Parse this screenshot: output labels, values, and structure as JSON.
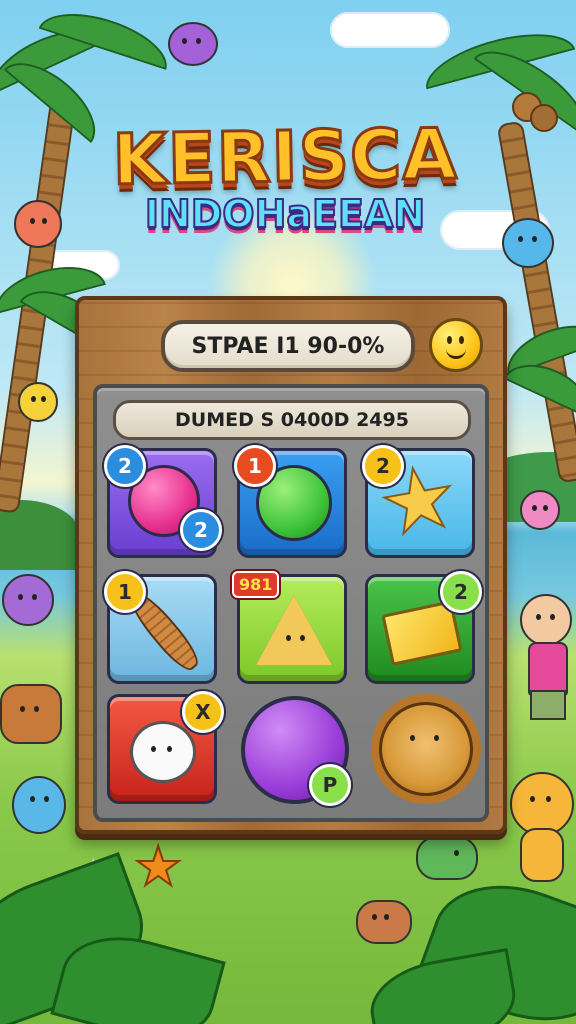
{
  "game": {
    "title": "KERISCA",
    "subtitle": "INDOHaEEAN"
  },
  "hud": {
    "status_text": "STPAE I1 90-0%",
    "score_text": "DUMED S 0400D 2495",
    "mood_icon": "smiley-face-icon"
  },
  "board": {
    "tiles": [
      {
        "name": "pink-gem-tile",
        "icon": "pink-orb",
        "badges": [
          "2",
          "2"
        ],
        "tile_color": "#7b4fe0",
        "item_color": "#e8318f"
      },
      {
        "name": "green-gem-tile",
        "icon": "green-orb",
        "badges": [
          "1"
        ],
        "tile_color": "#1f7fd6",
        "item_color": "#3fc43a"
      },
      {
        "name": "star-tile",
        "icon": "yellow-star",
        "badges": [
          "2"
        ],
        "tile_color": "#48b7e8",
        "item_color": "#f4c43a"
      },
      {
        "name": "carrot-tile",
        "icon": "carrot",
        "badges": [
          "1"
        ],
        "tile_color": "#6db6e0",
        "item_color": "#c07a3a"
      },
      {
        "name": "nacho-tile",
        "icon": "nacho-chip",
        "badges": [
          "981"
        ],
        "tile_color": "#8fd43a",
        "item_color": "#f2c85a"
      },
      {
        "name": "envelope-tile",
        "icon": "yellow-envelope",
        "badges": [
          "2"
        ],
        "tile_color": "#2e9e2e",
        "item_color": "#f4d03a"
      },
      {
        "name": "bear-tile",
        "icon": "white-bear",
        "badges": [
          "X"
        ],
        "tile_color": "#e23a2a",
        "item_color": "#ffffff"
      },
      {
        "name": "purple-gem-tile",
        "icon": "purple-orb",
        "badges": [
          "P"
        ],
        "tile_color": "transparent",
        "item_color": "#9a3ed8"
      },
      {
        "name": "lion-tile",
        "icon": "lion-face",
        "badges": [],
        "tile_color": "transparent",
        "item_color": "#d89a3a"
      }
    ]
  }
}
